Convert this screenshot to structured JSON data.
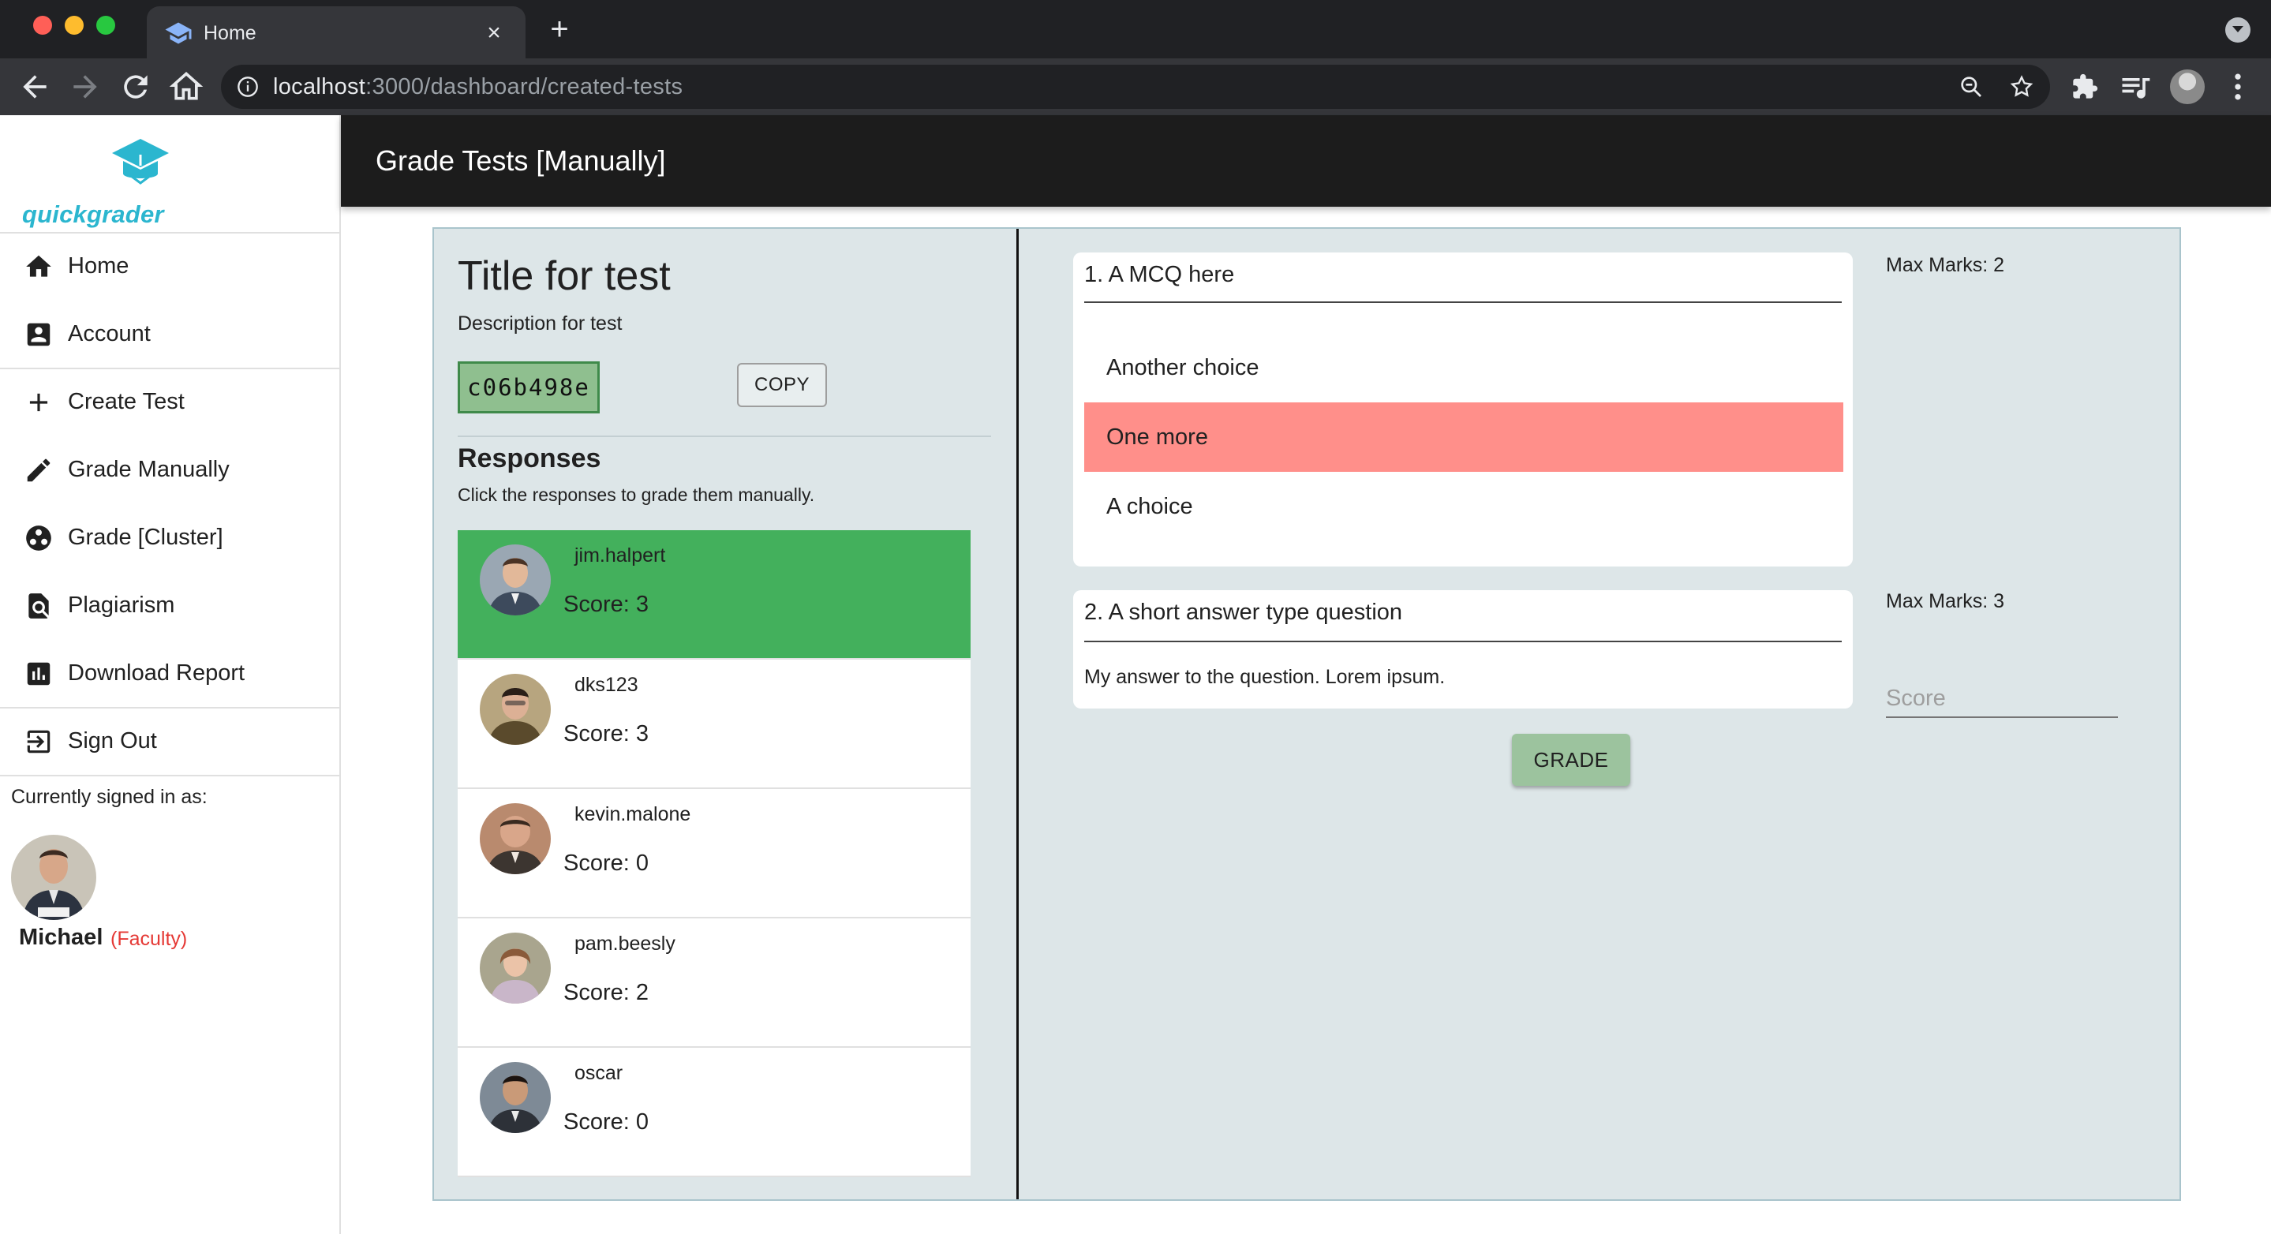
{
  "browser": {
    "tab_title": "Home",
    "url_host": "localhost",
    "url_path": ":3000/dashboard/created-tests"
  },
  "sidebar": {
    "logo_text": "quickgrader",
    "items": [
      {
        "label": "Home",
        "icon": "home-icon"
      },
      {
        "label": "Account",
        "icon": "account-box-icon"
      },
      {
        "label": "Create Test",
        "icon": "plus-icon"
      },
      {
        "label": "Grade Manually",
        "icon": "pencil-icon"
      },
      {
        "label": "Grade [Cluster]",
        "icon": "cluster-icon"
      },
      {
        "label": "Plagiarism",
        "icon": "find-in-page-icon"
      },
      {
        "label": "Download Report",
        "icon": "bar-chart-icon"
      },
      {
        "label": "Sign Out",
        "icon": "exit-icon"
      }
    ],
    "signed_in_label": "Currently signed in as:",
    "user_name": "Michael",
    "user_role": "(Faculty)"
  },
  "header": {
    "title": "Grade Tests [Manually]"
  },
  "test": {
    "title": "Title for test",
    "description": "Description for test",
    "code": "c06b498e",
    "copy_label": "COPY"
  },
  "responses": {
    "heading": "Responses",
    "subtitle": "Click the responses to grade them manually.",
    "items": [
      {
        "name": "jim.halpert",
        "score": "Score: 3",
        "selected": true
      },
      {
        "name": "dks123",
        "score": "Score: 3",
        "selected": false
      },
      {
        "name": "kevin.malone",
        "score": "Score: 0",
        "selected": false
      },
      {
        "name": "pam.beesly",
        "score": "Score: 2",
        "selected": false
      },
      {
        "name": "oscar",
        "score": "Score: 0",
        "selected": false
      }
    ]
  },
  "questions": [
    {
      "title": "1. A MCQ here",
      "max_marks": "Max Marks: 2",
      "choices": [
        {
          "label": "Another choice",
          "state": "normal"
        },
        {
          "label": "One more",
          "state": "wrong"
        },
        {
          "label": "A choice",
          "state": "normal"
        }
      ]
    },
    {
      "title": "2. A short answer type question",
      "max_marks": "Max Marks: 3",
      "answer": "My answer to the question. Lorem ipsum.",
      "score_placeholder": "Score"
    }
  ],
  "grade_label": "GRADE",
  "colors": {
    "selected_response": "#43b05c",
    "wrong_choice": "#ff8f8a",
    "appbar": "#1c1c1c",
    "panel": "#dde6e8",
    "brand": "#2bb6cf"
  }
}
